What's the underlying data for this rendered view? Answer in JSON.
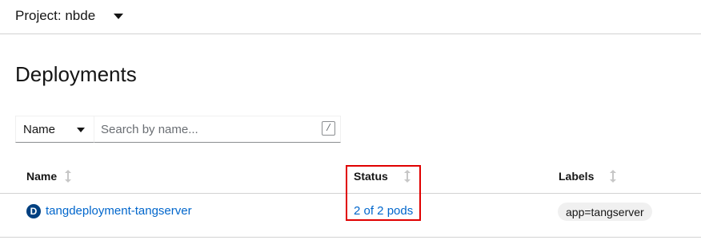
{
  "project": {
    "label": "Project: nbde"
  },
  "page": {
    "title": "Deployments"
  },
  "filter": {
    "type_label": "Name",
    "search_placeholder": "Search by name...",
    "shortcut_hint": "/"
  },
  "table": {
    "columns": [
      {
        "label": "Name",
        "sortable": true
      },
      {
        "label": "Status",
        "sortable": true
      },
      {
        "label": "Labels",
        "sortable": true
      }
    ],
    "rows": [
      {
        "resource_badge": "D",
        "name": "tangdeployment-tangserver",
        "status": "2 of 2 pods",
        "label": "app=tangserver"
      }
    ]
  },
  "colors": {
    "link": "#0066cc",
    "badge_bg": "#004080",
    "highlight": "#e00000"
  },
  "icons": {
    "project_toggle": "caret-down-icon",
    "filter_toggle": "caret-down-icon",
    "sort": "sort-icon",
    "resource": "deployment-badge-icon"
  }
}
